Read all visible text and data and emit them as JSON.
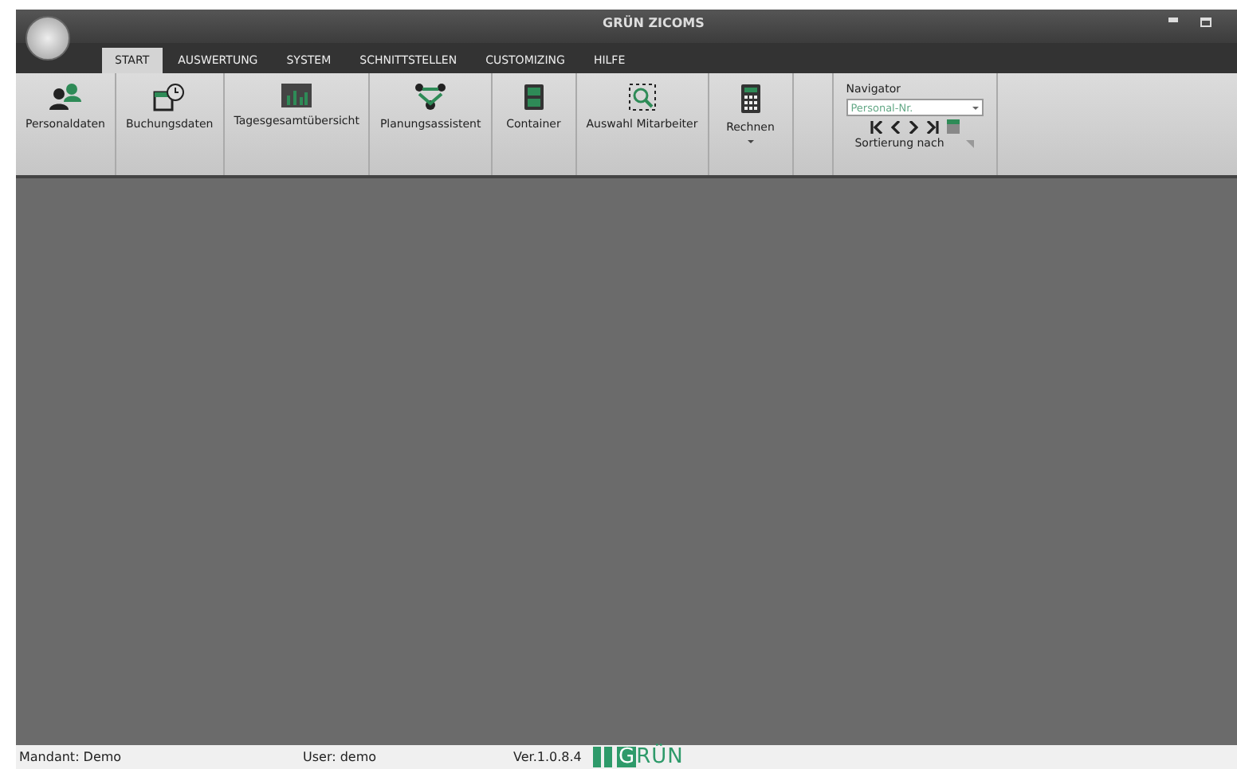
{
  "window": {
    "title": "GRÜN ZICOMS"
  },
  "tabs": [
    {
      "label": "START",
      "selected": true
    },
    {
      "label": "AUSWERTUNG",
      "selected": false
    },
    {
      "label": "SYSTEM",
      "selected": false
    },
    {
      "label": "SCHNITTSTELLEN",
      "selected": false
    },
    {
      "label": "CUSTOMIZING",
      "selected": false
    },
    {
      "label": "HILFE",
      "selected": false
    }
  ],
  "ribbon": {
    "buttons": [
      {
        "label": "Personaldaten",
        "kind": "people",
        "dropdown": false
      },
      {
        "label": "Buchungsdaten",
        "kind": "calendar",
        "dropdown": false
      },
      {
        "label": "Tagesgesamtübersicht",
        "kind": "chart",
        "dropdown": false
      },
      {
        "label": "Planungsassistent",
        "kind": "team",
        "dropdown": false
      },
      {
        "label": "Container",
        "kind": "cabinet",
        "dropdown": false
      },
      {
        "label": "Auswahl Mitarbeiter",
        "kind": "select",
        "dropdown": false
      },
      {
        "label": "Rechnen",
        "kind": "calculator",
        "dropdown": true
      }
    ],
    "navigator": {
      "title": "Navigator",
      "field": {
        "placeholder": "Personal-Nr."
      },
      "footer": "Sortierung nach"
    }
  },
  "status_bar": {
    "mandant": "Mandant: Demo",
    "user": "User: demo",
    "version": "Ver.1.0.8.4",
    "logo_mark": "G",
    "logo_text": "RÜN"
  }
}
